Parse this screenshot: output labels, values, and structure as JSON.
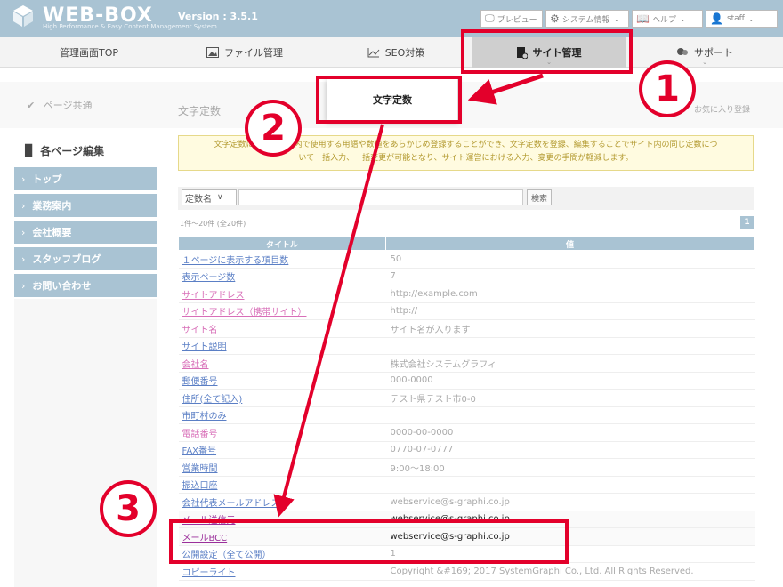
{
  "header": {
    "logo_text": "WEB-BOX",
    "logo_sub": "High Performance & Easy Content Management System",
    "version": "Version : 3.5.1",
    "buttons": {
      "preview": "プレビュー",
      "system": "システム情報",
      "help": "ヘルプ",
      "user": "staff"
    }
  },
  "nav": {
    "items": [
      {
        "label": "管理画面TOP"
      },
      {
        "label": "ファイル管理"
      },
      {
        "label": "SEO対策"
      },
      {
        "label": "サイト管理"
      },
      {
        "label": "サポート"
      }
    ]
  },
  "subbar": {
    "page_common": "ページ共通",
    "title_faded": "文字定数",
    "favorite": "お気に入り登録"
  },
  "popup": {
    "label": "文字定数"
  },
  "sidebar": {
    "heading": "各ページ編集",
    "items": [
      {
        "label": "トップ"
      },
      {
        "label": "業務案内"
      },
      {
        "label": "会社概要"
      },
      {
        "label": "スタッフブログ"
      },
      {
        "label": "お問い合わせ"
      }
    ]
  },
  "info": {
    "line1": "文字定数には、サイト内で使用する用語や数値をあらかじめ登録することができ、文字定数を登録、編集することでサイト内の同じ定数につ",
    "line2": "いて一括入力、一括変更が可能となり、サイト運営における入力、変更の手間が軽減します。"
  },
  "search": {
    "select_value": "定数名",
    "button": "検索"
  },
  "pager": {
    "count": "1件～20件 (全20件)",
    "page": "1"
  },
  "table": {
    "headers": [
      "タイトル",
      "値"
    ],
    "rows": [
      {
        "title": "１ページに表示する項目数",
        "value": "50"
      },
      {
        "title": "表示ページ数",
        "value": "7"
      },
      {
        "title": "サイトアドレス",
        "value": "http://example.com"
      },
      {
        "title": "サイトアドレス（携帯サイト）",
        "value": "http://"
      },
      {
        "title": "サイト名",
        "value": "サイト名が入ります"
      },
      {
        "title": "サイト説明",
        "value": ""
      },
      {
        "title": "会社名",
        "value": "株式会社システムグラフィ"
      },
      {
        "title": "郵便番号",
        "value": "000-0000"
      },
      {
        "title": "住所(全て記入)",
        "value": "テスト県テスト市0-0"
      },
      {
        "title": "市町村のみ",
        "value": ""
      },
      {
        "title": "電話番号",
        "value": "0000-00-0000"
      },
      {
        "title": "FAX番号",
        "value": "0770-07-0777"
      },
      {
        "title": "営業時間",
        "value": "9:00～18:00"
      },
      {
        "title": "振込口座",
        "value": ""
      },
      {
        "title": "会社代表メールアドレス",
        "value": "webservice@s-graphi.co.jp"
      },
      {
        "title": "メール送信元",
        "value": "webservice@s-graphi.co.jp"
      },
      {
        "title": "メールBCC",
        "value": "webservice@s-graphi.co.jp"
      },
      {
        "title": "公開設定（全て公開）",
        "value": "1"
      },
      {
        "title": "コピーライト",
        "value": "Copyright &#169; 2017 SystemGraphi Co., Ltd. All Rights Reserved."
      }
    ]
  },
  "annotations": {
    "c1": "1",
    "c2": "2",
    "c3": "3",
    "color": "#e3002b"
  },
  "colors": {
    "accent": "#a9c3d3"
  }
}
